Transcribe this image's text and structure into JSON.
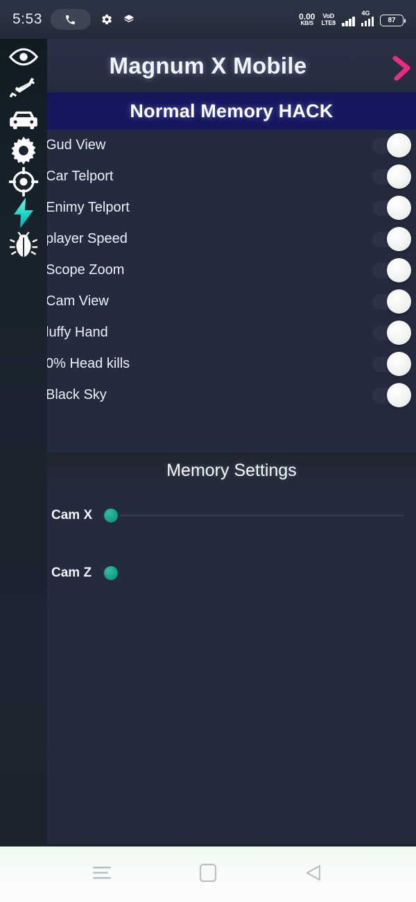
{
  "statusbar": {
    "time": "5:53",
    "call_icon": "phone-call-icon",
    "gear_icon": "gear-icon",
    "layers_icon": "layers-icon",
    "net_speed_value": "0.00",
    "net_speed_unit": "KB/S",
    "volte_line1": "VoD",
    "volte_line2": "LTE8",
    "network_type": "4G",
    "battery_level": "87"
  },
  "titlebar": {
    "title": "Magnum X Mobile",
    "eye_icon": "eye-icon",
    "close_icon": "close-x-icon",
    "close_color": "#ef2b7e"
  },
  "sidebar": {
    "items": [
      {
        "icon": "eye-icon",
        "name": "sidebar-item-esp-view"
      },
      {
        "icon": "rifle-icon",
        "name": "sidebar-item-weapon"
      },
      {
        "icon": "car-icon",
        "name": "sidebar-item-vehicle"
      },
      {
        "icon": "gear-icon",
        "name": "sidebar-item-settings"
      },
      {
        "icon": "crosshair-icon",
        "name": "sidebar-item-aimbot"
      },
      {
        "icon": "lightning-icon",
        "name": "sidebar-item-speed"
      },
      {
        "icon": "bug-icon",
        "name": "sidebar-item-memory-hack"
      }
    ]
  },
  "section": {
    "banner_title": "Normal Memory HACK",
    "banner_color": "#171760"
  },
  "toggles": [
    {
      "label": "Gud View",
      "state": "off"
    },
    {
      "label": "Car Telport",
      "state": "off"
    },
    {
      "label": "Enimy Telport",
      "state": "off"
    },
    {
      "label": "player Speed",
      "state": "off"
    },
    {
      "label": "Scope Zoom",
      "state": "off"
    },
    {
      "label": "Cam View",
      "state": "off"
    },
    {
      "label": "luffy Hand",
      "state": "off"
    },
    {
      "label": "0% Head kills",
      "state": "off"
    },
    {
      "label": "Black Sky",
      "state": "off"
    }
  ],
  "memory_settings": {
    "heading": "Memory Settings",
    "sliders": [
      {
        "label": "Cam X",
        "position": "min",
        "thumb_color": "#16a085",
        "has_track": true
      },
      {
        "label": "Cam Z",
        "position": "min",
        "thumb_color": "#16a085",
        "has_track": false
      }
    ]
  },
  "navbar": {
    "buttons": [
      {
        "icon": "recents-menu-icon",
        "name": "nav-recents-button"
      },
      {
        "icon": "home-square-icon",
        "name": "nav-home-button"
      },
      {
        "icon": "back-triangle-icon",
        "name": "nav-back-button"
      }
    ]
  }
}
